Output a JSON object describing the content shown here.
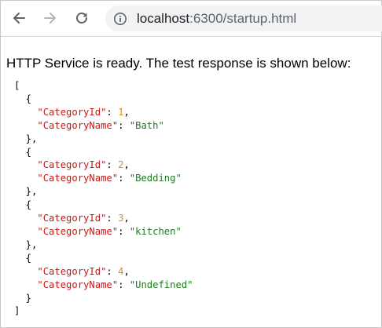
{
  "browser": {
    "url_host": "localhost",
    "url_rest": ":6300/startup.html",
    "icons": [
      "back-arrow-icon",
      "forward-arrow-icon",
      "reload-icon",
      "info-icon"
    ]
  },
  "page": {
    "heading": "HTTP Service is ready. The test response is shown below:",
    "response": [
      {
        "CategoryId": 1,
        "CategoryName": "Bath"
      },
      {
        "CategoryId": 2,
        "CategoryName": "Bedding"
      },
      {
        "CategoryId": 3,
        "CategoryName": "kitchen"
      },
      {
        "CategoryId": 4,
        "CategoryName": "Undefined"
      }
    ]
  },
  "colors": {
    "key": "#c41a16",
    "number": "#e08a1e",
    "string": "#1a7f1a"
  }
}
